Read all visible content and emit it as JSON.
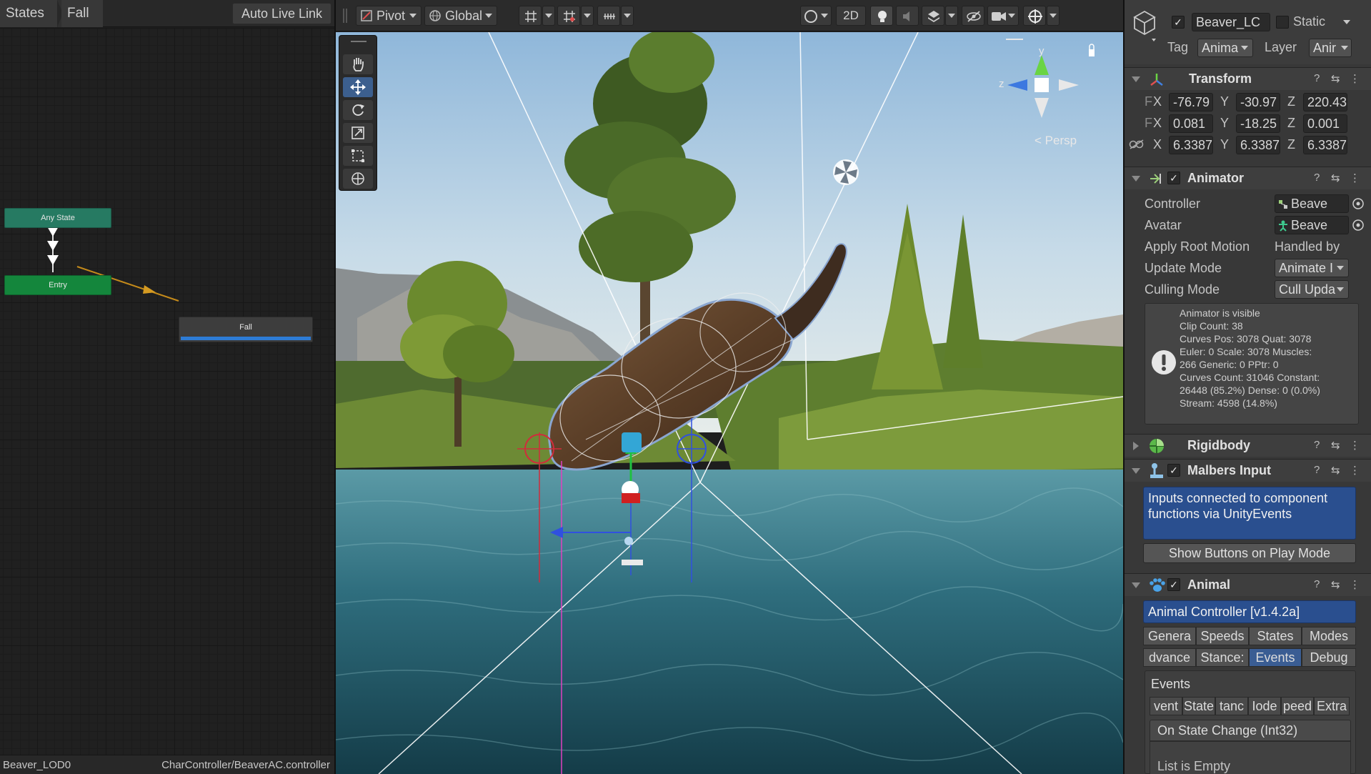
{
  "animator": {
    "breadcrumb": [
      "States",
      "Fall"
    ],
    "live_link_label": "Auto Live Link",
    "nodes": {
      "any_state": "Any State",
      "entry": "Entry",
      "fall": "Fall"
    },
    "footer_left": "Beaver_LOD0",
    "footer_right": "CharController/BeaverAC.controller"
  },
  "scene": {
    "toolbar": {
      "pivot_label": "Pivot",
      "global_label": "Global",
      "mode_2d_label": "2D"
    },
    "gizmo": {
      "axis_y": "y",
      "axis_z": "z",
      "persp_label": "Persp"
    },
    "tools": [
      "hand-tool",
      "move-tool",
      "rotate-tool",
      "scale-tool",
      "rect-tool",
      "transform-tool"
    ],
    "active_tool": "move-tool"
  },
  "inspector": {
    "object_name": "Beaver_LC",
    "static_label": "Static",
    "tag_label": "Tag",
    "tag_value": "Anima",
    "layer_label": "Layer",
    "layer_value": "Anir",
    "transform": {
      "title": "Transform",
      "position": {
        "prefix": "F",
        "x": "-76.79",
        "y": "-30.97",
        "z": "220.43"
      },
      "rotation": {
        "prefix": "F",
        "x": "0.081",
        "y": "-18.25",
        "z": "0.001"
      },
      "scale": {
        "x": "6.3387",
        "y": "6.3387",
        "z": "6.3387"
      },
      "axis_labels": {
        "x": "X",
        "y": "Y",
        "z": "Z"
      }
    },
    "animator": {
      "title": "Animator",
      "controller_label": "Controller",
      "controller_value": "Beave",
      "avatar_label": "Avatar",
      "avatar_value": "Beave",
      "apply_root_motion_label": "Apply Root Motion",
      "apply_root_motion_value": "Handled by",
      "update_mode_label": "Update Mode",
      "update_mode_value": "Animate I",
      "culling_mode_label": "Culling Mode",
      "culling_mode_value": "Cull Upda",
      "info": "Animator is visible\nClip Count: 38\nCurves Pos: 3078 Quat: 3078\nEuler: 0 Scale: 3078 Muscles:\n266 Generic: 0 PPtr: 0\nCurves Count: 31046 Constant:\n26448 (85.2%) Dense: 0 (0.0%)\nStream: 4598 (14.8%)"
    },
    "rigidbody": {
      "title": "Rigidbody"
    },
    "malbers_input": {
      "title": "Malbers Input",
      "info": "Inputs connected to component functions via UnityEvents",
      "button": "Show Buttons on Play Mode"
    },
    "animal": {
      "title": "Animal",
      "banner": "Animal Controller [v1.4.2a]",
      "tabs_row1": [
        "Genera",
        "Speeds",
        "States",
        "Modes"
      ],
      "tabs_row2": [
        "dvance",
        "Stance:",
        "Events",
        "Debug"
      ],
      "selected_tab": "Events",
      "events_label": "Events",
      "event_tabs": [
        "vent",
        "State",
        "tanc",
        "Iode",
        "peed",
        "Extra"
      ],
      "event_name": "On State Change (Int32)",
      "list_empty": "List is Empty"
    }
  },
  "colors": {
    "accent_blue": "#2d7cd6",
    "node_any": "#267a62",
    "node_entry": "#14863c",
    "transition": "#c48a1a"
  }
}
